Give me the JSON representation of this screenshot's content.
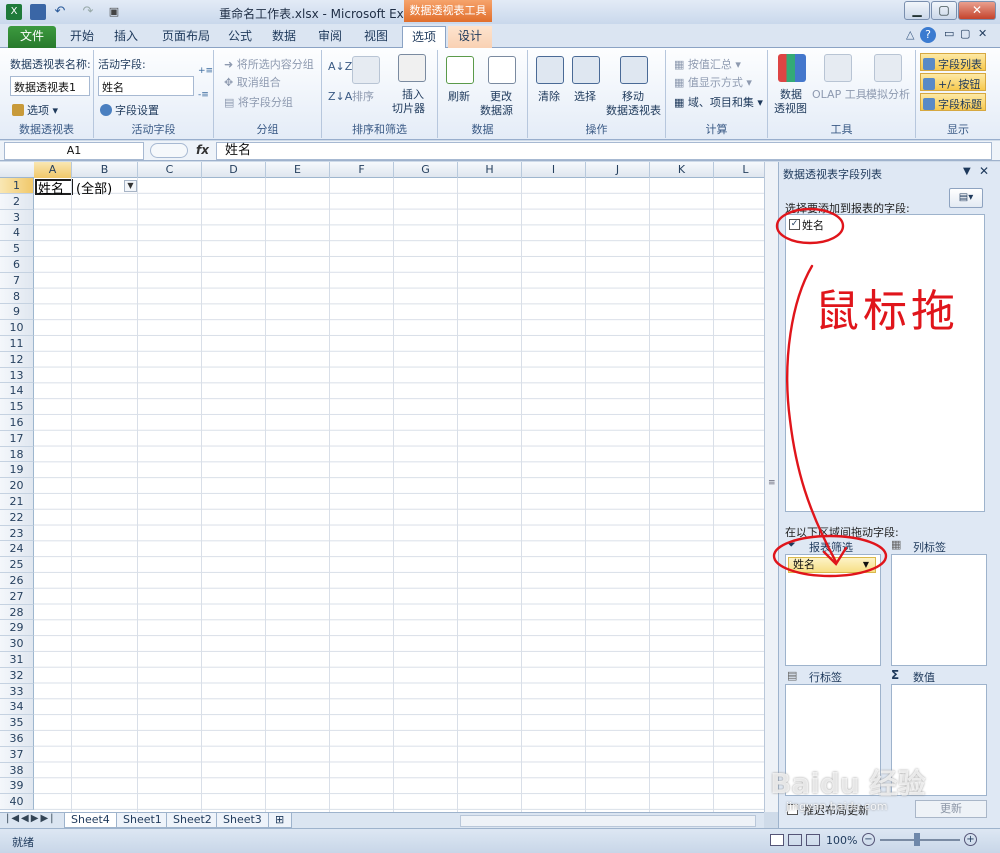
{
  "window": {
    "title": "重命名工作表.xlsx - Microsoft Excel",
    "context_tab_group": "数据透视表工具",
    "buttons": [
      "▁",
      "▢",
      "✕"
    ],
    "mini_buttons": [
      "△",
      "?",
      "▭",
      "▢",
      "✕"
    ]
  },
  "tabs": [
    "文件",
    "开始",
    "插入",
    "页面布局",
    "公式",
    "数据",
    "审阅",
    "视图",
    "选项",
    "设计"
  ],
  "ribbon": {
    "pivot_name_label": "数据透视表名称:",
    "pivot_name_value": "数据透视表1",
    "options_label": "选项",
    "group_pivot": "数据透视表",
    "active_field_label": "活动字段:",
    "active_field_value": "姓名",
    "field_settings": "字段设置",
    "group_active_field": "活动字段",
    "group_items": [
      "将所选内容分组",
      "取消组合",
      "将字段分组"
    ],
    "group_group": "分组",
    "sort_label": "排序",
    "insert_slicer": "插入",
    "insert_slicer2": "切片器",
    "group_sort": "排序和筛选",
    "refresh": "刷新",
    "change_source": "更改",
    "change_source2": "数据源",
    "group_data": "数据",
    "clear": "清除",
    "select": "选择",
    "move": "移动",
    "move2": "数据透视表",
    "group_actions": "操作",
    "calc_items": [
      "按值汇总",
      "值显示方式",
      "域、项目和集"
    ],
    "group_calc": "计算",
    "pivot_chart": "数据",
    "pivot_chart2": "透视图",
    "olap": "OLAP 工具",
    "whatif": "模拟分析",
    "group_tools": "工具",
    "show_items": [
      "字段列表",
      "+/- 按钮",
      "字段标题"
    ],
    "group_show": "显示"
  },
  "formula_bar": {
    "name_box": "A1",
    "fx": "fx",
    "value": "姓名"
  },
  "columns": [
    "A",
    "B",
    "C",
    "D",
    "E",
    "F",
    "G",
    "H",
    "I",
    "J",
    "K",
    "L"
  ],
  "rows": [
    "1",
    "2",
    "3",
    "4",
    "5",
    "6",
    "7",
    "8",
    "9",
    "10",
    "11",
    "12",
    "13",
    "14",
    "15",
    "16",
    "17",
    "18",
    "19",
    "20",
    "21",
    "22",
    "23",
    "24",
    "25",
    "26",
    "27",
    "28",
    "29",
    "30",
    "31",
    "32",
    "33",
    "34",
    "35",
    "36",
    "37",
    "38",
    "39",
    "40"
  ],
  "cells": {
    "A1": "姓名",
    "B1": "(全部)"
  },
  "sheets": [
    "Sheet4",
    "Sheet1",
    "Sheet2",
    "Sheet3"
  ],
  "status": {
    "ready": "就绪",
    "zoom": "100%"
  },
  "panel": {
    "title": "数据透视表字段列表",
    "choose_label": "选择要添加到报表的字段:",
    "field_name": "姓名",
    "drag_label": "在以下区域间拖动字段:",
    "report_filter": "报表筛选",
    "column_labels": "列标签",
    "row_labels": "行标签",
    "values": "数值",
    "filter_chip": "姓名",
    "defer_label": "推迟布局更新",
    "update_button": "更新"
  },
  "annotation": {
    "text": "鼠标拖",
    "color": "#e0151b"
  },
  "watermark": {
    "text": "Baidu 经验",
    "url": "jingyan.baidu.com"
  }
}
